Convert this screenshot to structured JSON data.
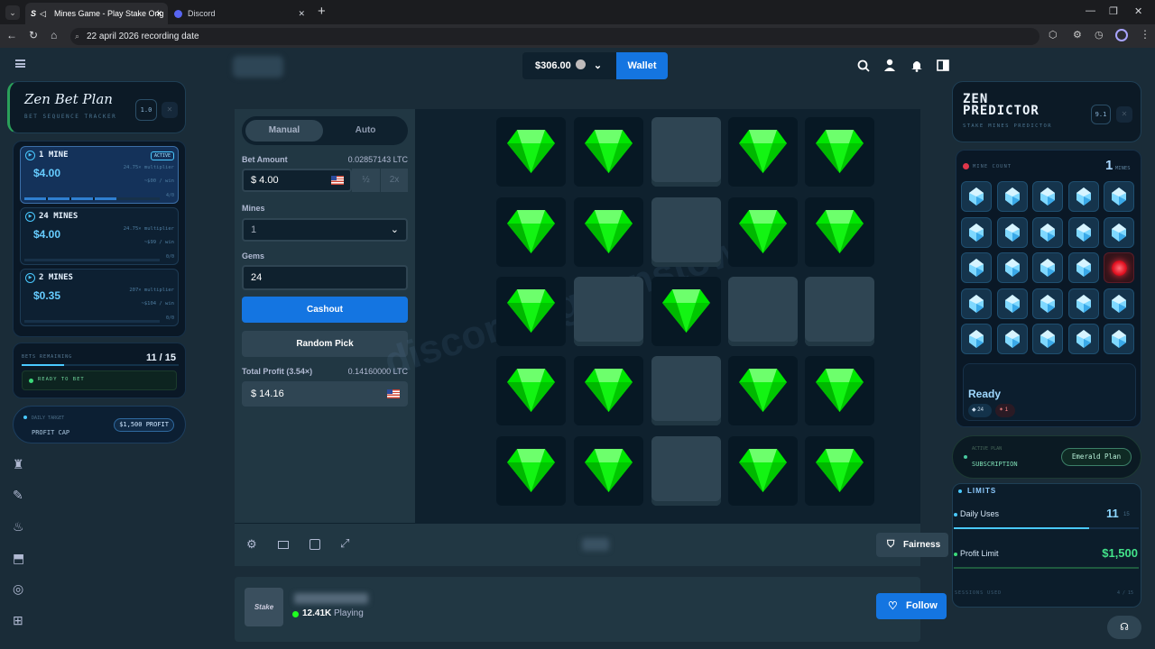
{
  "browser": {
    "tabs": [
      {
        "title": "Mines Game - Play Stake Orig",
        "active": true
      },
      {
        "title": "Discord",
        "active": false
      }
    ],
    "address": "22 april 2026 recording date"
  },
  "header": {
    "balance": "$306.00",
    "wallet_label": "Wallet"
  },
  "controls": {
    "mode_tabs": [
      "Manual",
      "Auto"
    ],
    "bet_amount_label": "Bet Amount",
    "bet_amount_ltc": "0.02857143 LTC",
    "bet_amount_value": "$ 4.00",
    "half_label": "½",
    "double_label": "2x",
    "mines_label": "Mines",
    "mines_value": "1",
    "gems_label": "Gems",
    "gems_value": "24",
    "cashout_label": "Cashout",
    "random_pick_label": "Random Pick",
    "total_profit_label": "Total Profit (3.54×)",
    "total_profit_ltc": "0.14160000 LTC",
    "total_profit_value": "$ 14.16"
  },
  "board": {
    "rows": [
      [
        "gem",
        "gem",
        "hidden",
        "gem",
        "gem"
      ],
      [
        "gem",
        "gem",
        "hidden",
        "gem",
        "gem"
      ],
      [
        "gem",
        "hidden",
        "gem",
        "hidden",
        "hidden"
      ],
      [
        "gem",
        "gem",
        "hidden",
        "gem",
        "gem"
      ],
      [
        "gem",
        "gem",
        "hidden",
        "gem",
        "gem"
      ]
    ]
  },
  "watermark": "discord.gg/zenstown",
  "footer": {
    "fairness_label": "Fairness",
    "playing_count": "12.41K",
    "playing_label": "Playing",
    "follow_label": "Follow"
  },
  "zen_plan": {
    "title": "Zen Bet Plan",
    "subtitle": "BET SEQUENCE TRACKER",
    "version": "1.0",
    "plans": [
      {
        "name": "1 MINE",
        "badge": "ACTIVE",
        "amount": "$4.00",
        "multiplier": "24.75× multiplier",
        "rate": "~$00 / win",
        "progress": "4/0"
      },
      {
        "name": "24 MINES",
        "amount": "$4.00",
        "multiplier": "24.75× multiplier",
        "rate": "~$99 / win",
        "progress": "0/0"
      },
      {
        "name": "2 MINES",
        "amount": "$0.35",
        "multiplier": "207× multiplier",
        "rate": "~$104 / win",
        "progress": "0/0"
      }
    ],
    "bets_remaining_label": "BETS REMAINING",
    "bets_remaining": "11 / 15",
    "ready_label": "READY TO BET",
    "daily_target_label": "DAILY TARGET",
    "profit_cap_label": "PROFIT CAP",
    "profit_cap_value": "$1,500 PROFIT"
  },
  "predictor": {
    "title_line1": "ZEN",
    "title_line2": "PREDICTOR",
    "subtitle": "STAKE MINES PREDICTOR",
    "version": "9.1",
    "mine_count_label": "MINE COUNT",
    "mine_count": "1",
    "mine_unit": "MINES",
    "grid": [
      [
        "gem",
        "gem",
        "gem",
        "gem",
        "gem"
      ],
      [
        "gem",
        "gem",
        "gem",
        "gem",
        "gem"
      ],
      [
        "gem",
        "gem",
        "gem",
        "gem",
        "bomb"
      ],
      [
        "gem",
        "gem",
        "gem",
        "gem",
        "gem"
      ],
      [
        "gem",
        "gem",
        "gem",
        "gem",
        "gem"
      ]
    ],
    "status": "Ready",
    "gems_count": "24",
    "bombs_count": "1",
    "active_plan_label": "ACTIVE PLAN",
    "subscription_label": "SUBSCRIPTION",
    "plan_name": "Emerald Plan",
    "limits_label": "LIMITS",
    "daily_uses_label": "Daily Uses",
    "daily_uses": "11",
    "daily_uses_max": "15",
    "profit_limit_label": "Profit Limit",
    "profit_limit": "$1,500",
    "sessions_label": "SESSIONS USED",
    "sessions_value": "4 / 15"
  },
  "colors": {
    "accent": "#1475e1",
    "gem": "#00e701",
    "bg": "#1a2c38",
    "panel": "#213743",
    "board": "#0f212e",
    "neon": "#49c9ff"
  }
}
